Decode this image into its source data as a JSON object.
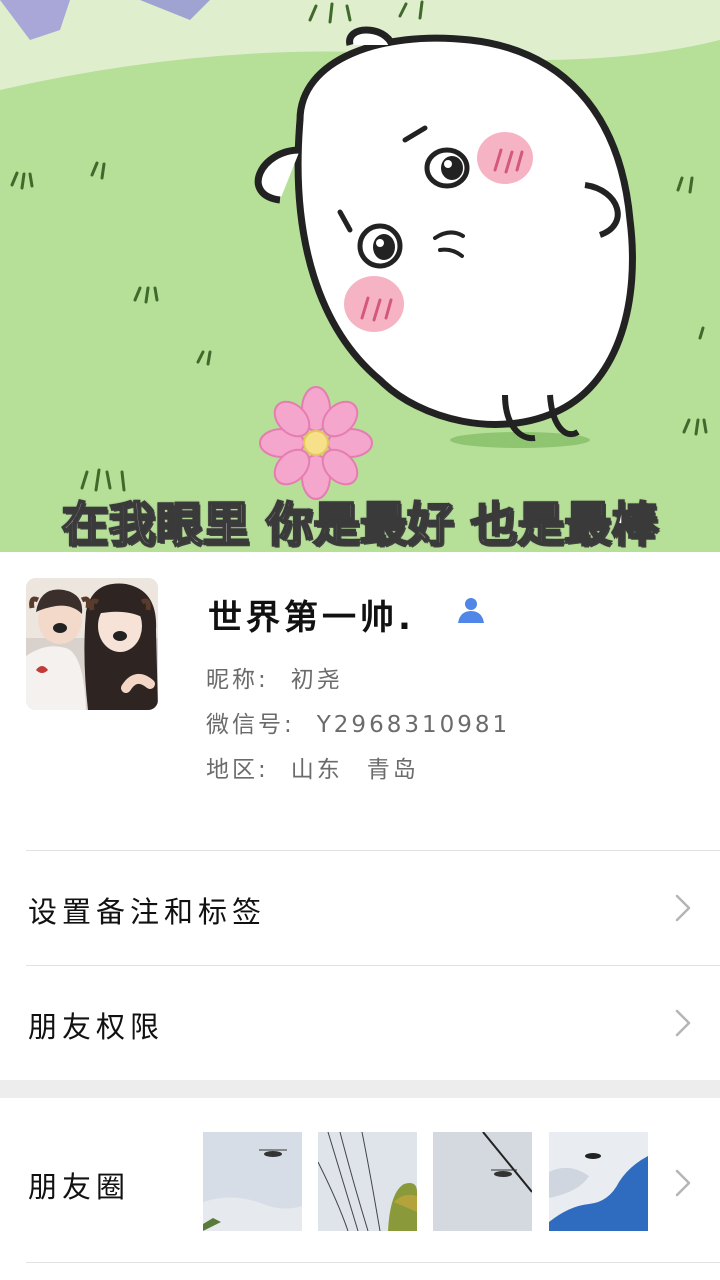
{
  "cover": {
    "caption": "在我眼里 你是最好 也是最棒",
    "icons": [
      "hamster-illustration",
      "flower-icon"
    ]
  },
  "profile": {
    "display_name": "世界第一帅.",
    "nickname_label": "昵称:",
    "nickname": "初尧",
    "wechat_id_label": "微信号:",
    "wechat_id": "Y2968310981",
    "region_label": "地区:",
    "region_province": "山东",
    "region_city": "青岛",
    "badge_icon": "person-icon",
    "badge_color": "#4f86e8"
  },
  "rows": {
    "remark_label": "设置备注和标签",
    "permission_label": "朋友权限",
    "moments_label": "朋友圈"
  },
  "colors": {
    "divider": "#e2e2e2",
    "gap_band": "#ededed",
    "label_gray": "#6b6b6b",
    "chevron": "#b5b5b5"
  }
}
